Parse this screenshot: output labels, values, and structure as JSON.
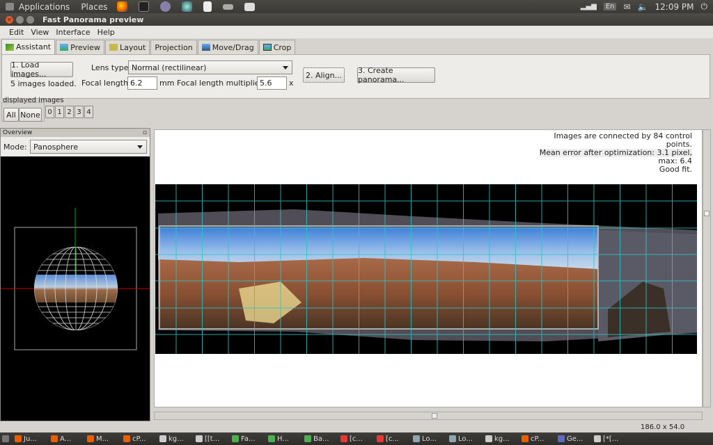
{
  "topbar": {
    "applications": "Applications",
    "places": "Places",
    "lang": "En",
    "clock": "12:09 PM",
    "launcher_icons": [
      "firefox-icon",
      "terminal-icon",
      "gimp-icon",
      "network-icon",
      "document-icon",
      "tool-icon",
      "printer-icon"
    ]
  },
  "window": {
    "title": "Fast Panorama preview"
  },
  "menu": [
    "Edit",
    "View",
    "Interface",
    "Help"
  ],
  "tabs": [
    "Assistant",
    "Preview",
    "Layout",
    "Projection",
    "Move/Drag",
    "Crop"
  ],
  "assistant": {
    "load_button": "1. Load images...",
    "loaded_status": "5 images loaded.",
    "lens_type_label": "Lens type:",
    "lens_type_value": "Normal (rectilinear)",
    "focal_length_label": "Focal length:",
    "focal_length_value": "6.2",
    "focal_length_unit": "mm",
    "multiplier_label": "Focal length multiplier:",
    "multiplier_value": "5.6",
    "multiplier_unit": "x",
    "align_button": "2. Align...",
    "create_button": "3. Create panorama..."
  },
  "displayed": {
    "label": "displayed images",
    "all": "All",
    "none": "None",
    "numbers": [
      "0",
      "1",
      "2",
      "3",
      "4"
    ]
  },
  "overview": {
    "title": "Overview",
    "mode_label": "Mode:",
    "mode_value": "Panosphere"
  },
  "preview": {
    "info_lines": [
      "Images are connected by 84 control",
      "points.",
      "Mean error after optimization: 3.1 pixel,",
      "max: 6.4",
      "Good fit."
    ]
  },
  "status": {
    "fov": "186.0 x 54.0"
  },
  "taskbar": [
    {
      "label": "Ju...",
      "color": "#e66000"
    },
    {
      "label": "A...",
      "color": "#e66000"
    },
    {
      "label": "M...",
      "color": "#e66000"
    },
    {
      "label": "cP...",
      "color": "#e66000"
    },
    {
      "label": "kg...",
      "color": "#ccc"
    },
    {
      "label": "[[t...",
      "color": "#ccc"
    },
    {
      "label": "Fa...",
      "color": "#4caf50"
    },
    {
      "label": "H...",
      "color": "#4caf50"
    },
    {
      "label": "Ba...",
      "color": "#4caf50"
    },
    {
      "label": "[c...",
      "color": "#e53935"
    },
    {
      "label": "[c...",
      "color": "#e53935"
    },
    {
      "label": "Lo...",
      "color": "#90a4ae"
    },
    {
      "label": "Lo...",
      "color": "#90a4ae"
    },
    {
      "label": "kg...",
      "color": "#ccc"
    },
    {
      "label": "cP...",
      "color": "#e66000"
    },
    {
      "label": "Ge...",
      "color": "#5c6bc0"
    },
    {
      "label": "[*[...",
      "color": "#ccc"
    }
  ]
}
